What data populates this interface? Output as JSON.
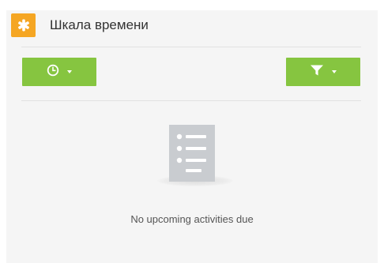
{
  "widget": {
    "title": "Шкала времени",
    "header_icon": "asterisk-icon",
    "accent_color": "#f5a623"
  },
  "toolbar": {
    "time_button": {
      "icon": "clock-icon",
      "has_dropdown": true
    },
    "filter_button": {
      "icon": "filter-icon",
      "has_dropdown": true
    },
    "button_color": "#86c540"
  },
  "empty_state": {
    "icon": "document-list-icon",
    "message": "No upcoming activities due"
  }
}
